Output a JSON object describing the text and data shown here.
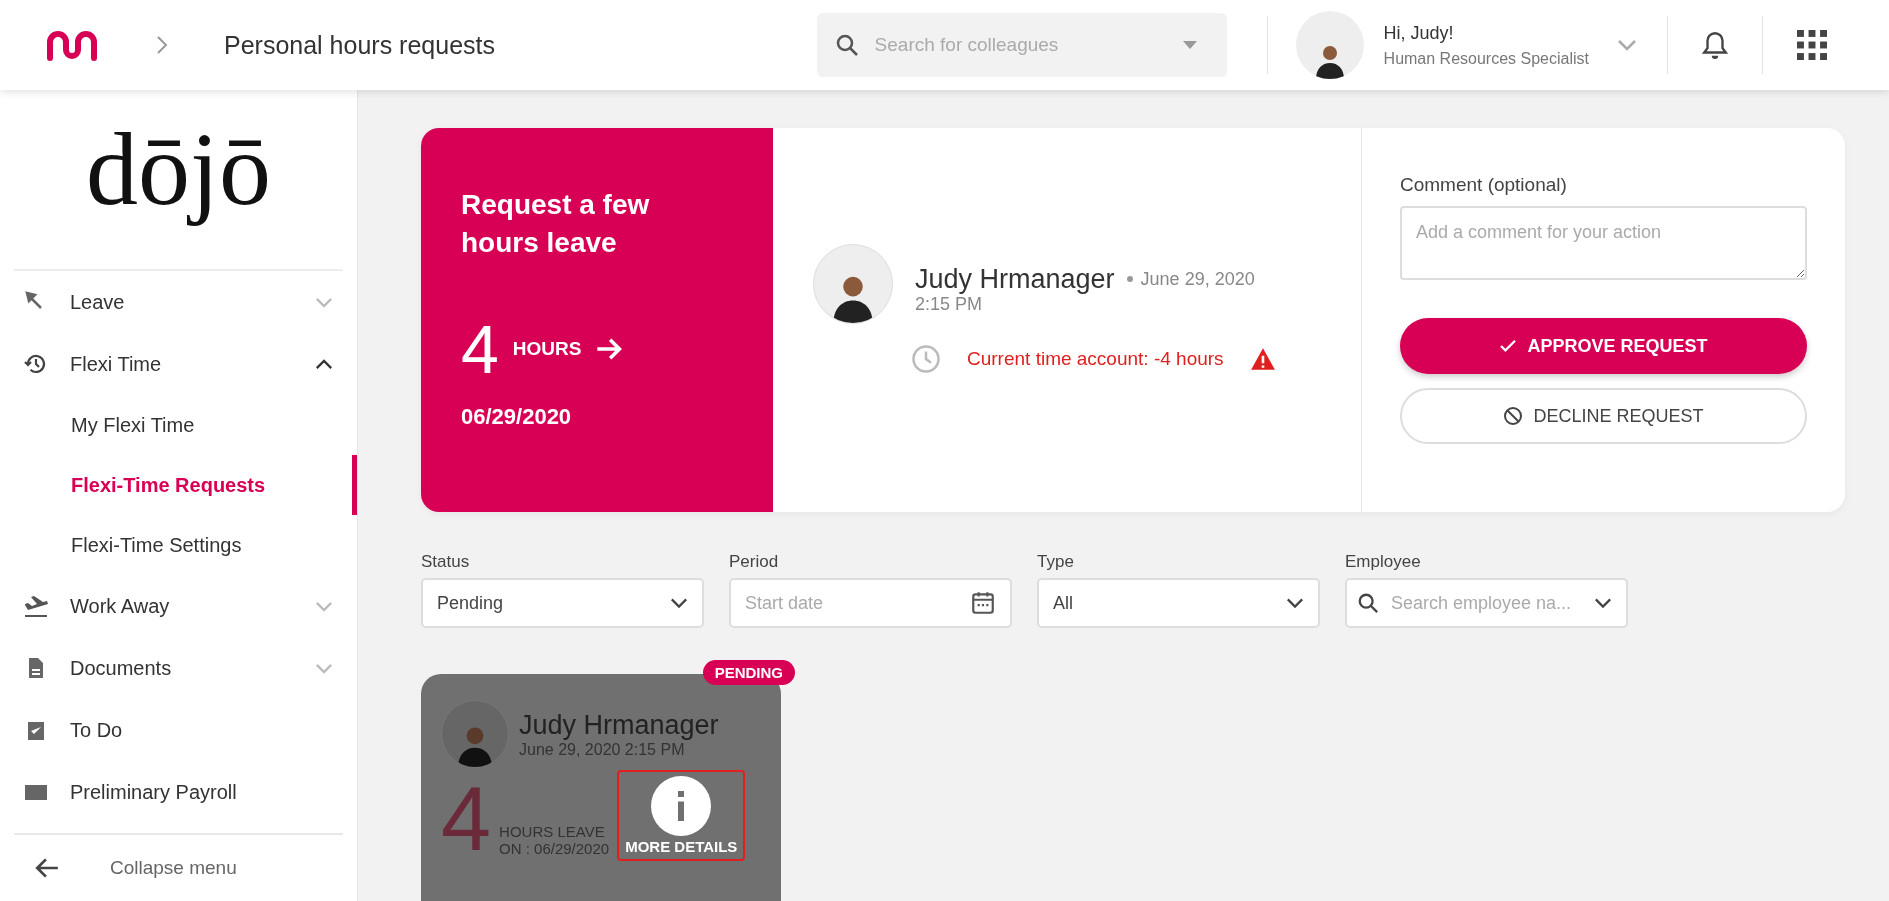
{
  "header": {
    "page_title": "Personal hours requests",
    "search": {
      "placeholder": "Search for colleagues"
    },
    "user": {
      "greeting": "Hi, Judy!",
      "role": "Human Resources Specialist"
    }
  },
  "sidebar": {
    "logo": "dōjō",
    "items": [
      {
        "label": "Leave",
        "expanded": false
      },
      {
        "label": "Flexi Time",
        "expanded": true,
        "children": [
          {
            "label": "My Flexi Time",
            "selected": false
          },
          {
            "label": "Flexi-Time Requests",
            "selected": true
          },
          {
            "label": "Flexi-Time Settings",
            "selected": false
          }
        ]
      },
      {
        "label": "Work Away",
        "expanded": false
      },
      {
        "label": "Documents",
        "expanded": false
      },
      {
        "label": "To Do"
      },
      {
        "label": "Preliminary Payroll"
      }
    ],
    "collapse": "Collapse menu"
  },
  "request_card": {
    "title": "Request a few hours leave",
    "hours": "4",
    "hours_unit": "HOURS",
    "date": "06/29/2020",
    "employee": {
      "name": "Judy Hrmanager",
      "date": "June 29, 2020",
      "time": "2:15 PM"
    },
    "warning": "Current time account: -4 hours",
    "comment": {
      "label": "Comment (optional)",
      "placeholder": "Add a comment for your action"
    },
    "buttons": [
      {
        "label": "APPROVE REQUEST",
        "kind": "approve"
      },
      {
        "label": "DECLINE REQUEST",
        "kind": "decline"
      }
    ]
  },
  "filters": [
    {
      "label": "Status",
      "kind": "select",
      "value": "Pending"
    },
    {
      "label": "Period",
      "kind": "date",
      "placeholder": "Start date"
    },
    {
      "label": "Type",
      "kind": "select",
      "value": "All"
    },
    {
      "label": "Employee",
      "kind": "search",
      "placeholder": "Search employee na..."
    }
  ],
  "requests": [
    {
      "name": "Judy Hrmanager",
      "datetime": "June 29, 2020 2:15 PM",
      "hours": "4",
      "unit": "HOURS LEAVE",
      "on": "ON : 06/29/2020",
      "status": "PENDING",
      "action": "MORE DETAILS"
    }
  ]
}
